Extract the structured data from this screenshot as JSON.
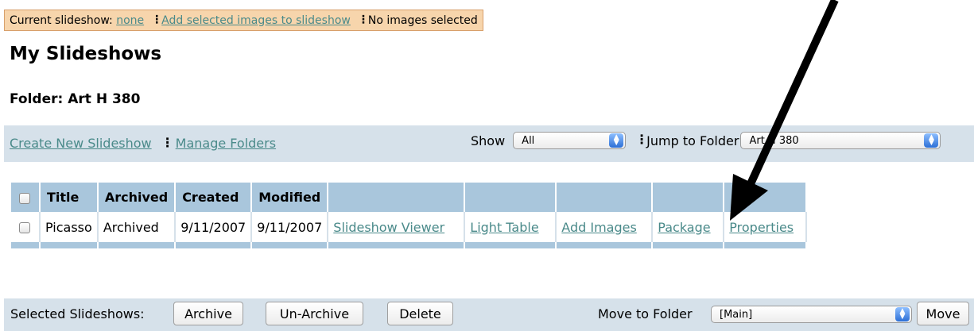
{
  "status_bar": {
    "current_label": "Current slideshow:",
    "current_value": "none",
    "add_link": "Add selected images to slideshow",
    "selection_status": "No images selected"
  },
  "page_title": "My Slideshows",
  "folder_heading": "Folder: Art H 380",
  "toolbar": {
    "create_link": "Create New Slideshow",
    "manage_link": "Manage Folders",
    "show_label": "Show",
    "show_value": "All",
    "jump_label": "Jump to Folder",
    "jump_value": "Art H 380"
  },
  "table": {
    "headers": [
      "Title",
      "Archived",
      "Created",
      "Modified"
    ],
    "rows": [
      {
        "title": "Picasso",
        "archived": "Archived",
        "created": "9/11/2007",
        "modified": "9/11/2007",
        "actions": [
          "Slideshow Viewer",
          "Light Table",
          "Add Images",
          "Package",
          "Properties"
        ]
      }
    ]
  },
  "bottom_bar": {
    "selected_label": "Selected Slideshows:",
    "archive_button": "Archive",
    "unarchive_button": "Un-Archive",
    "delete_button": "Delete",
    "move_label": "Move to Folder",
    "move_value": "[Main]",
    "move_button": "Move"
  },
  "colors": {
    "status_bg": "#f7d5ac",
    "toolbar_bg": "#d6e1ea",
    "header_bg": "#a9c6dc",
    "link": "#4a8a8a"
  },
  "icons": {
    "separator": "vertical-dots-icon",
    "select_arrow": "updown-arrow-icon",
    "annotation": "pointer-arrow"
  }
}
